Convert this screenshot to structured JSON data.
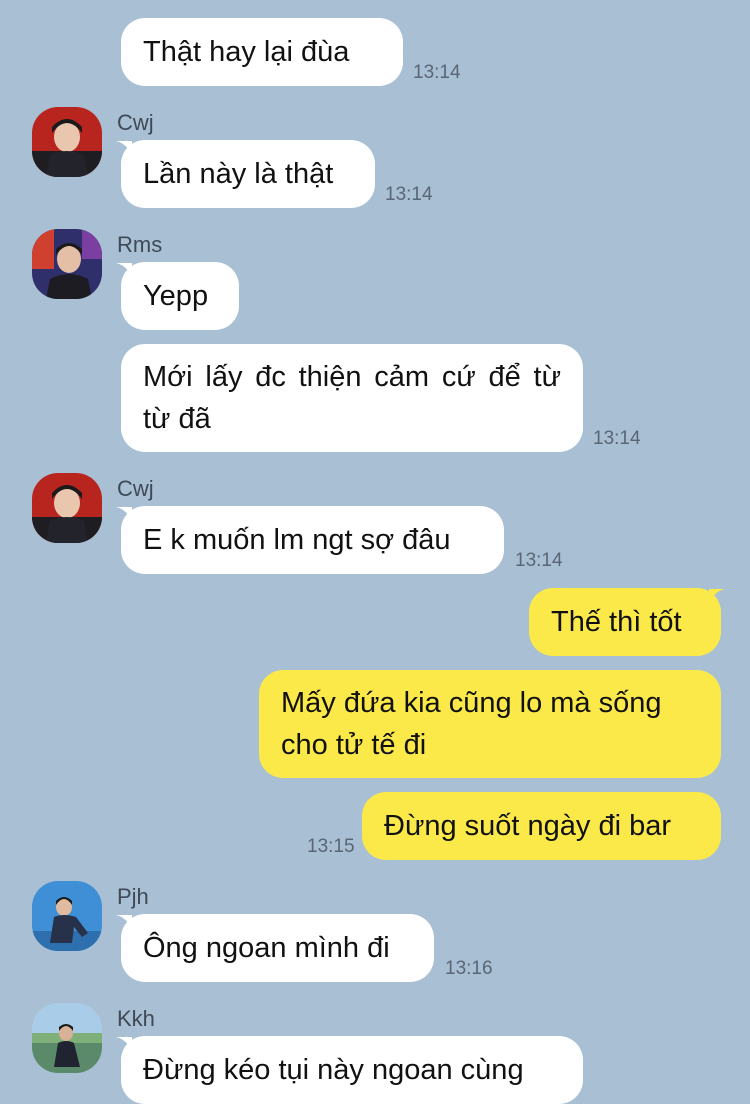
{
  "messages": [
    {
      "id": "m1",
      "side": "in",
      "text": "Thật hay lại đùa",
      "time": "13:14"
    },
    {
      "id": "m2",
      "side": "in",
      "sender": "Cwj",
      "text": "Lần này là thật",
      "time": "13:14"
    },
    {
      "id": "m3",
      "side": "in",
      "sender": "Rms",
      "text": "Yepp"
    },
    {
      "id": "m4",
      "side": "in",
      "text": "Mới lấy đc thiện cảm cứ để từ từ đã",
      "time": "13:14"
    },
    {
      "id": "m5",
      "side": "in",
      "sender": "Cwj",
      "text": "E k muốn lm ngt sợ đâu",
      "time": "13:14"
    },
    {
      "id": "m6",
      "side": "out",
      "text": "Thế thì tốt"
    },
    {
      "id": "m7",
      "side": "out",
      "text": "Mấy đứa kia cũng lo mà sống cho tử tế đi"
    },
    {
      "id": "m8",
      "side": "out",
      "text": "Đừng suốt ngày đi bar",
      "time": "13:15"
    },
    {
      "id": "m9",
      "side": "in",
      "sender": "Pjh",
      "text": "Ông ngoan mình đi",
      "time": "13:16"
    },
    {
      "id": "m10",
      "side": "in",
      "sender": "Kkh",
      "text": "Đừng kéo tụi này ngoan cùng"
    }
  ],
  "colors": {
    "background": "#a9bfd3",
    "incoming": "#ffffff",
    "outgoing": "#fbe94a"
  },
  "icons": {
    "avatar_cwj": "user-avatar-photo",
    "avatar_rms": "user-avatar-photo",
    "avatar_pjh": "user-avatar-photo",
    "avatar_kkh": "user-avatar-photo"
  }
}
